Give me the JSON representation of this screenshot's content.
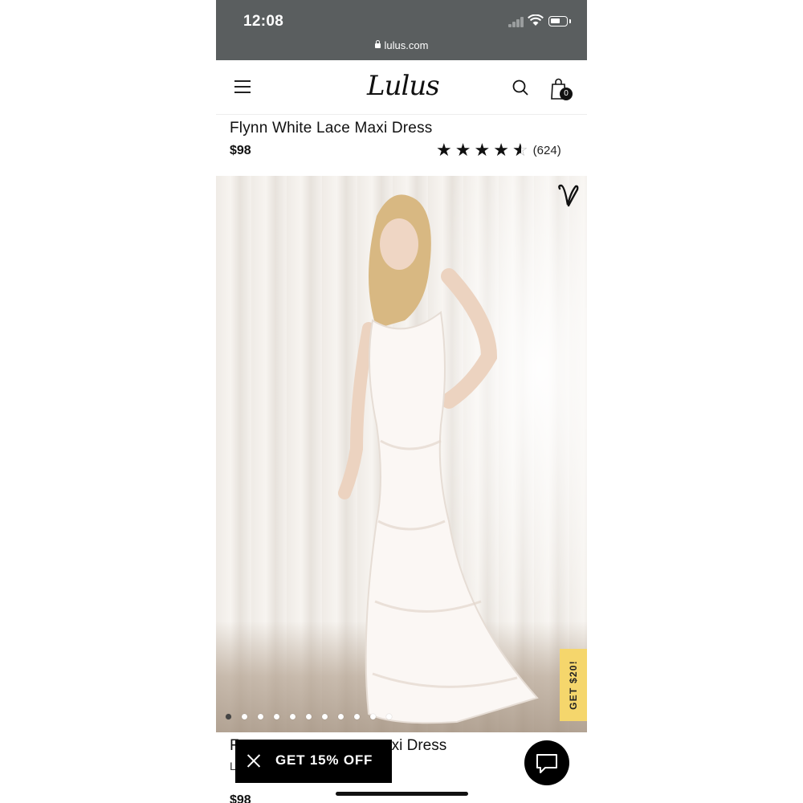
{
  "status_bar": {
    "time": "12:08",
    "url": "lulus.com"
  },
  "header": {
    "logo": "Lulus",
    "cart_count": "0"
  },
  "product": {
    "title": "Flynn White Lace Maxi Dress",
    "price": "$98",
    "rating": 4.5,
    "rating_count": "(624)"
  },
  "gallery": {
    "image_count": 11,
    "active_index": 0,
    "side_tab_label": "GET $20!"
  },
  "below": {
    "title_left": "F",
    "title_right": "xi Dress",
    "sub_left": "L",
    "price": "$98"
  },
  "promo": {
    "label": "GET 15% OFF"
  },
  "colors": {
    "status_bg": "#5a5e5f",
    "accent_yellow": "#f5d66c",
    "text": "#111111"
  }
}
